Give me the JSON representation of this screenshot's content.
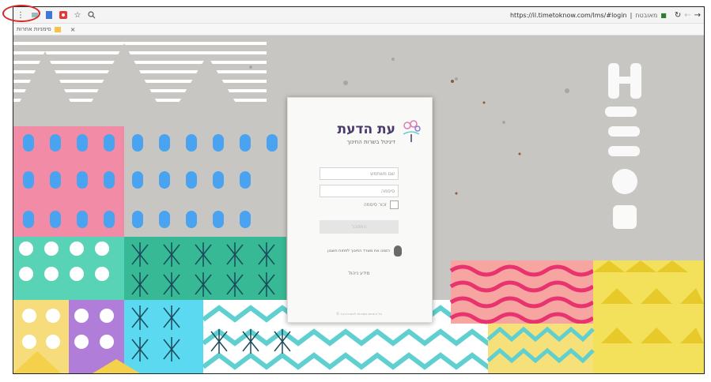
{
  "browser": {
    "menu_icon": "⋮",
    "url": "https://il.timetoknow.com/lms/#login",
    "secure_label": "מאובטח",
    "tab_close": "×"
  },
  "bookmarks": {
    "item1": "סימניות אחרות"
  },
  "login": {
    "logo_title": "עת הדעת",
    "logo_subtitle": "דיגיטל בשרות החינוך",
    "username_placeholder": "שם משתמש",
    "password_placeholder": "סיסמה",
    "remember_label": "זכור סיסמה",
    "login_button": "התחבר",
    "forgot_text": "הזמנו את משרד החינוך לפתוח חשבון",
    "support_link": "מידע ניהול",
    "footer": "© כל הזכויות שמורות לחברת ת.ה"
  },
  "colors": {
    "annotation": "#d62828",
    "brand_purple": "#4b3a6e"
  }
}
